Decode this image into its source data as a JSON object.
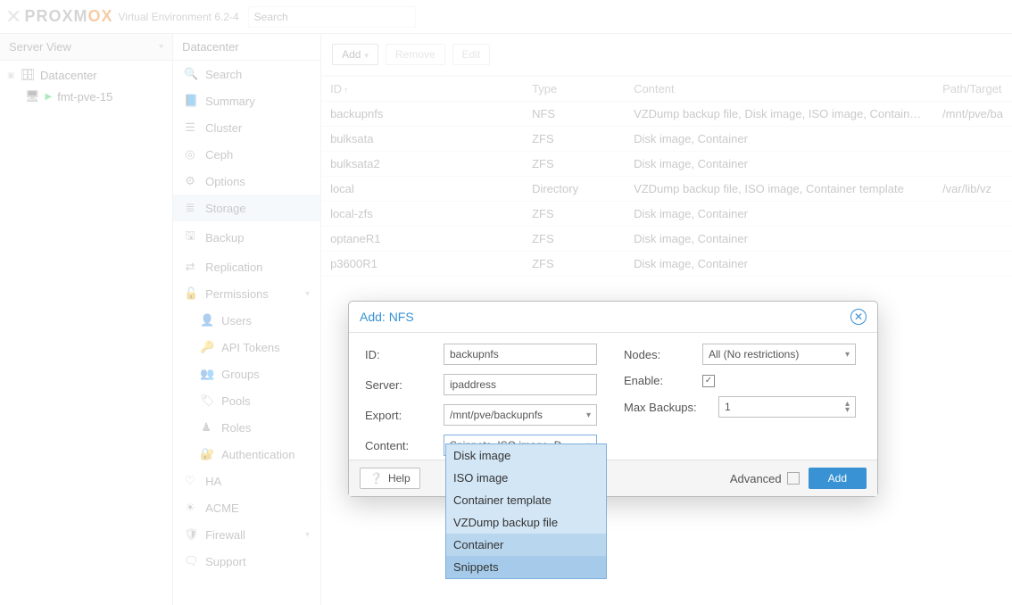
{
  "header": {
    "brand_prefix": "PR",
    "brand_mid": "O",
    "brand_suffix": "XM",
    "brand_end": "OX",
    "env_label": "Virtual Environment 6.2-4",
    "search_placeholder": "Search"
  },
  "leftpanel": {
    "header": "Server View",
    "root_label": "Datacenter",
    "node_label": "fmt-pve-15"
  },
  "midpanel": {
    "header": "Datacenter",
    "items": [
      {
        "icon": "🔍",
        "label": "Search"
      },
      {
        "icon": "📘",
        "label": "Summary"
      },
      {
        "icon": "☰",
        "label": "Cluster"
      },
      {
        "icon": "◎",
        "label": "Ceph"
      },
      {
        "icon": "⚙",
        "label": "Options"
      },
      {
        "icon": "≣",
        "label": "Storage",
        "selected": true
      },
      {
        "icon": "🖫",
        "label": "Backup"
      },
      {
        "icon": "⇄",
        "label": "Replication"
      },
      {
        "icon": "🔓",
        "label": "Permissions",
        "caret": true
      },
      {
        "icon": "👤",
        "label": "Users",
        "sub": true
      },
      {
        "icon": "🔑",
        "label": "API Tokens",
        "sub": true
      },
      {
        "icon": "👥",
        "label": "Groups",
        "sub": true
      },
      {
        "icon": "🏷",
        "label": "Pools",
        "sub": true
      },
      {
        "icon": "♟",
        "label": "Roles",
        "sub": true
      },
      {
        "icon": "🔐",
        "label": "Authentication",
        "sub": true
      },
      {
        "icon": "♡",
        "label": "HA"
      },
      {
        "icon": "☀",
        "label": "ACME"
      },
      {
        "icon": "🛡",
        "label": "Firewall",
        "caret": true
      },
      {
        "icon": "🗨",
        "label": "Support"
      }
    ]
  },
  "toolbar": {
    "add_label": "Add",
    "remove_label": "Remove",
    "edit_label": "Edit"
  },
  "table": {
    "columns": [
      "ID",
      "Type",
      "Content",
      "Path/Target"
    ],
    "rows": [
      {
        "id": "backupnfs",
        "type": "NFS",
        "content": "VZDump backup file, Disk image, ISO image, Contain…",
        "path": "/mnt/pve/ba"
      },
      {
        "id": "bulksata",
        "type": "ZFS",
        "content": "Disk image, Container",
        "path": ""
      },
      {
        "id": "bulksata2",
        "type": "ZFS",
        "content": "Disk image, Container",
        "path": ""
      },
      {
        "id": "local",
        "type": "Directory",
        "content": "VZDump backup file, ISO image, Container template",
        "path": "/var/lib/vz"
      },
      {
        "id": "local-zfs",
        "type": "ZFS",
        "content": "Disk image, Container",
        "path": ""
      },
      {
        "id": "optaneR1",
        "type": "ZFS",
        "content": "Disk image, Container",
        "path": ""
      },
      {
        "id": "p3600R1",
        "type": "ZFS",
        "content": "Disk image, Container",
        "path": ""
      }
    ]
  },
  "dialog": {
    "title": "Add: NFS",
    "labels": {
      "id": "ID:",
      "server": "Server:",
      "export": "Export:",
      "content": "Content:",
      "nodes": "Nodes:",
      "enable": "Enable:",
      "maxbackups": "Max Backups:",
      "advanced": "Advanced",
      "help": "Help",
      "add": "Add"
    },
    "values": {
      "id": "backupnfs",
      "server": "ipaddress",
      "export": "/mnt/pve/backupnfs",
      "content": "Snippets, ISO image, D",
      "nodes": "All (No restrictions)",
      "maxbackups": "1",
      "enable_checked": true
    },
    "dropdown": [
      {
        "label": "Disk image",
        "sel": false
      },
      {
        "label": "ISO image",
        "sel": false
      },
      {
        "label": "Container template",
        "sel": false
      },
      {
        "label": "VZDump backup file",
        "sel": false
      },
      {
        "label": "Container",
        "sel": "h"
      },
      {
        "label": "Snippets",
        "sel": true
      }
    ]
  }
}
